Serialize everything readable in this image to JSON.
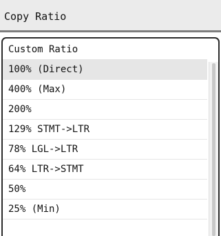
{
  "header": {
    "title": "Copy Ratio"
  },
  "list": {
    "items": [
      {
        "label": "Custom Ratio",
        "selected": false
      },
      {
        "label": "100% (Direct)",
        "selected": true
      },
      {
        "label": "400% (Max)",
        "selected": false
      },
      {
        "label": "200%",
        "selected": false
      },
      {
        "label": "129% STMT->LTR",
        "selected": false
      },
      {
        "label": "78% LGL->LTR",
        "selected": false
      },
      {
        "label": "64% LTR->STMT",
        "selected": false
      },
      {
        "label": "50%",
        "selected": false
      },
      {
        "label": "25% (Min)",
        "selected": false
      }
    ]
  },
  "colors": {
    "header_background": "#ebebeb",
    "selected_row": "#e6e6e6",
    "frame_border": "#2a2a2a"
  }
}
